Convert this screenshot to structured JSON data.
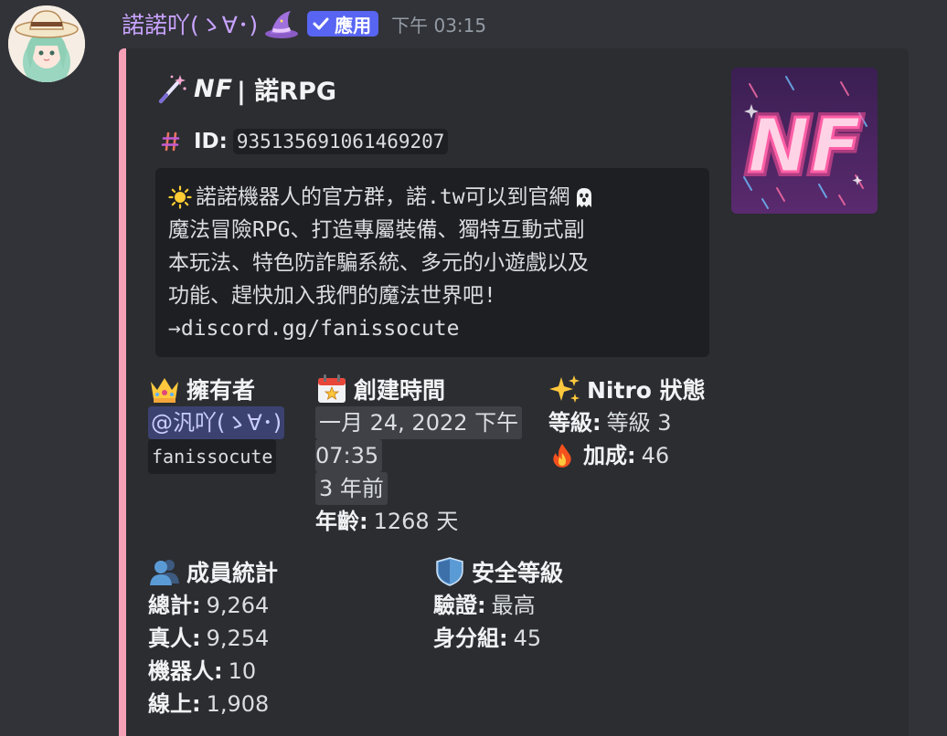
{
  "message": {
    "username": "諾諾吖(ゝ∀･)",
    "app_badge": "應用",
    "timestamp": "下午 03:15"
  },
  "embed": {
    "accent_color": "#f5a0b7",
    "title_nf": "NF",
    "title_rest": "| 諾RPG",
    "id_label": "ID:",
    "id_value": "935135691061469207",
    "description": [
      "諾諾機器人的官方群，諾.tw可以到官網",
      "魔法冒險RPG、打造專屬裝備、獨特互動式副",
      "本玩法、特色防詐騙系統、多元的小遊戲以及",
      "功能、趕快加入我們的魔法世界吧!",
      "→discord.gg/fanissocute"
    ],
    "thumbnail_text": "NF",
    "fields": {
      "owner": {
        "title": "擁有者",
        "mention": "@汎吖(ゝ∀･)",
        "username": "fanissocute"
      },
      "created": {
        "title": "創建時間",
        "date_line1": "一月 24, 2022 下午",
        "date_line2": "07:35",
        "relative": "3 年前",
        "age_label": "年齡:",
        "age_value": "1268 天"
      },
      "nitro": {
        "title": "Nitro 狀態",
        "level_label": "等級:",
        "level_value": "等級 3",
        "boost_label": "加成:",
        "boost_value": "46"
      },
      "members": {
        "title": "成員統計",
        "total_label": "總計:",
        "total_value": "9,264",
        "humans_label": "真人:",
        "humans_value": "9,254",
        "bots_label": "機器人:",
        "bots_value": "10",
        "online_label": "線上:",
        "online_value": "1,908"
      },
      "security": {
        "title": "安全等級",
        "verify_label": "驗證:",
        "verify_value": "最高",
        "roles_label": "身分組:",
        "roles_value": "45"
      }
    }
  }
}
